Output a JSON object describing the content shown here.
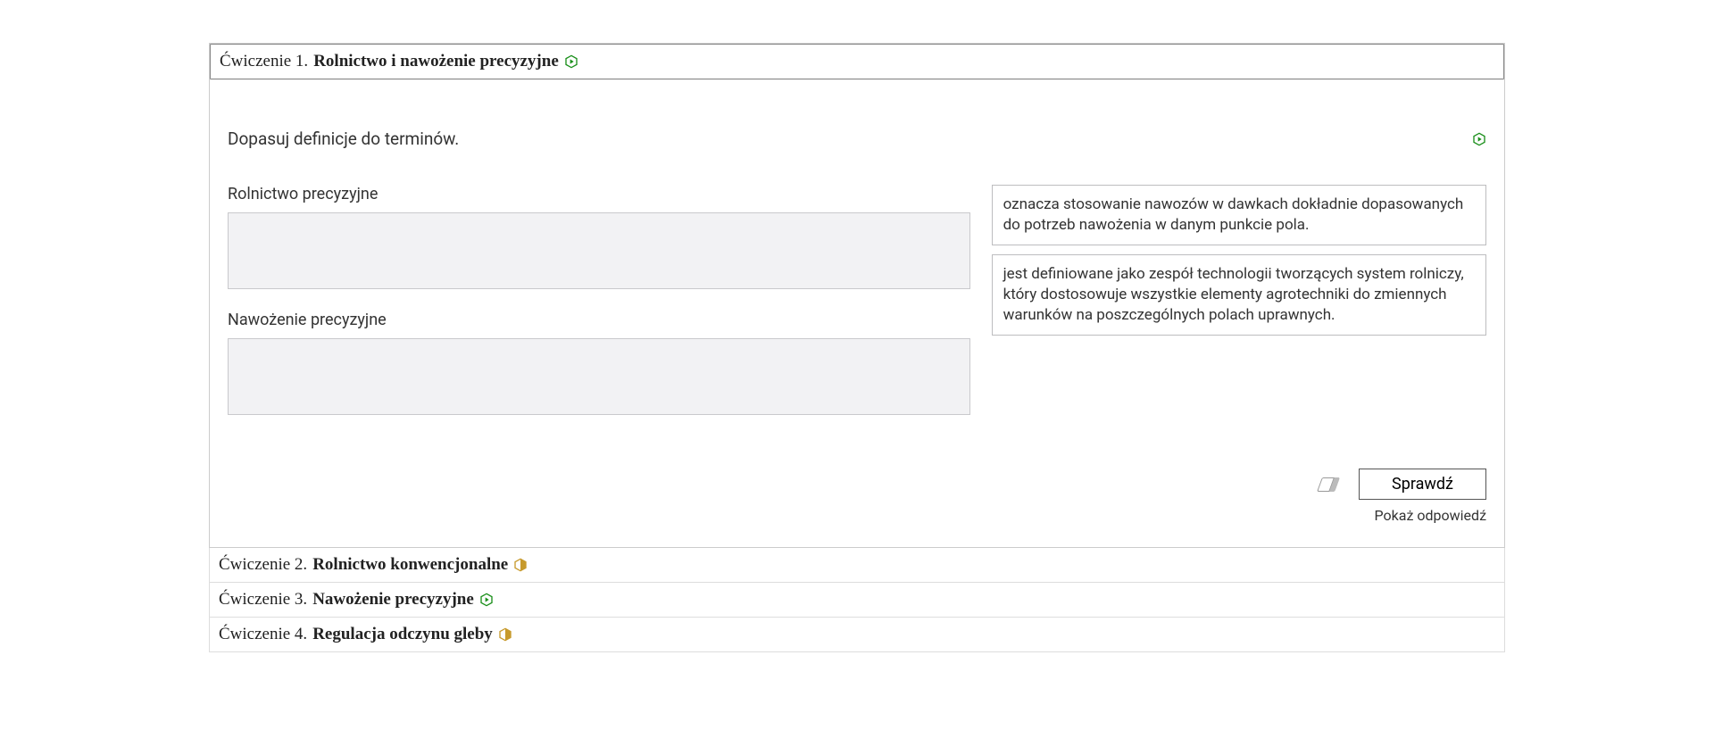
{
  "exercises": [
    {
      "num": "Ćwiczenie 1.",
      "title": "Rolnictwo i nawożenie precyzyjne",
      "badge_color": "#1a8f1a",
      "open": true,
      "body": {
        "instruction": "Dopasuj definicje do terminów.",
        "terms": [
          {
            "label": "Rolnictwo precyzyjne"
          },
          {
            "label": "Nawożenie precyzyjne"
          }
        ],
        "definitions": [
          {
            "text": "oznacza stosowanie nawozów w dawkach dokładnie dopasowanych do potrzeb nawożenia w danym punkcie pola."
          },
          {
            "text": "jest definiowane jako zespół technologii tworzących system rolniczy, który dostosowuje wszystkie elementy agrotechniki do zmiennych warunków na poszczególnych polach uprawnych."
          }
        ],
        "check_label": "Sprawdź",
        "show_answer_label": "Pokaż odpowiedź"
      }
    },
    {
      "num": "Ćwiczenie 2.",
      "title": "Rolnictwo konwencjonalne",
      "badge_color": "#c79a2c",
      "open": false
    },
    {
      "num": "Ćwiczenie 3.",
      "title": "Nawożenie precyzyjne",
      "badge_color": "#1a8f1a",
      "open": false
    },
    {
      "num": "Ćwiczenie 4.",
      "title": "Regulacja odczynu gleby",
      "badge_color": "#c79a2c",
      "open": false
    }
  ]
}
